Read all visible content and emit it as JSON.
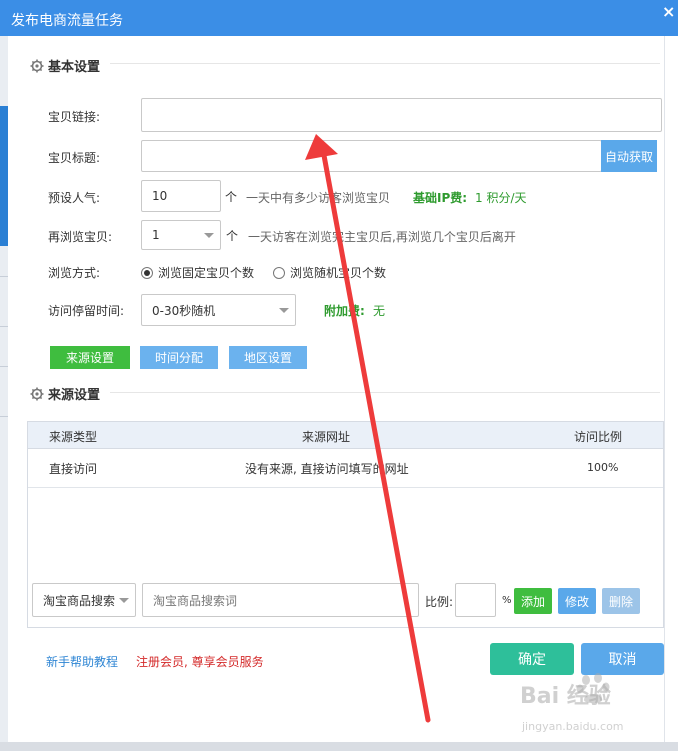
{
  "window": {
    "title": "发布电商流量任务",
    "close_label": "×"
  },
  "sections": {
    "basic_title": "基本设置",
    "source_title": "来源设置"
  },
  "form": {
    "link_label": "宝贝链接:",
    "link_value": "",
    "title_label": "宝贝标题:",
    "title_value": "",
    "fetch_button": "自动获取",
    "popularity_label": "预设人气:",
    "popularity_value": "10",
    "popularity_unit": "个",
    "popularity_hint": "一天中有多少访客浏览宝贝",
    "ip_fee_label": "基础IP费:",
    "ip_fee_value": "1 积分/天",
    "browse_more_label": "再浏览宝贝:",
    "browse_more_value": "1",
    "browse_more_unit": "个",
    "browse_more_hint": "一天访客在浏览完主宝贝后,再浏览几个宝贝后离开",
    "browse_mode_label": "浏览方式:",
    "browse_mode_options": [
      "浏览固定宝贝个数",
      "浏览随机宝贝个数"
    ],
    "browse_mode_selected": 0,
    "stay_label": "访问停留时间:",
    "stay_value": "0-30秒随机",
    "extra_fee_label": "附加费:",
    "extra_fee_value": "无"
  },
  "tabs": [
    "来源设置",
    "时间分配",
    "地区设置"
  ],
  "table": {
    "headers": [
      "来源类型",
      "来源网址",
      "访问比例"
    ],
    "rows": [
      {
        "type": "直接访问",
        "url": "没有来源, 直接访问填写的网址",
        "ratio": "100%"
      }
    ]
  },
  "source_controls": {
    "source_select": "淘宝商品搜索",
    "keyword_placeholder": "淘宝商品搜索词",
    "ratio_label": "比例:",
    "ratio_value": "",
    "percent": "%",
    "add": "添加",
    "edit": "修改",
    "delete": "删除"
  },
  "footer": {
    "help_link": "新手帮助教程",
    "member_link": "注册会员, 尊享会员服务",
    "confirm": "确定",
    "cancel": "取消"
  },
  "watermark": {
    "brand": "Bai 经验",
    "url": "jingyan.baidu.com"
  },
  "colors": {
    "titlebar": "#3b8ee6",
    "primary_button": "#5aa8ea",
    "active_tab": "#3fbd3f",
    "confirm": "#2ebf9a",
    "fee_green": "#2f9b2f",
    "annotation_arrow": "#ee3b3b"
  }
}
